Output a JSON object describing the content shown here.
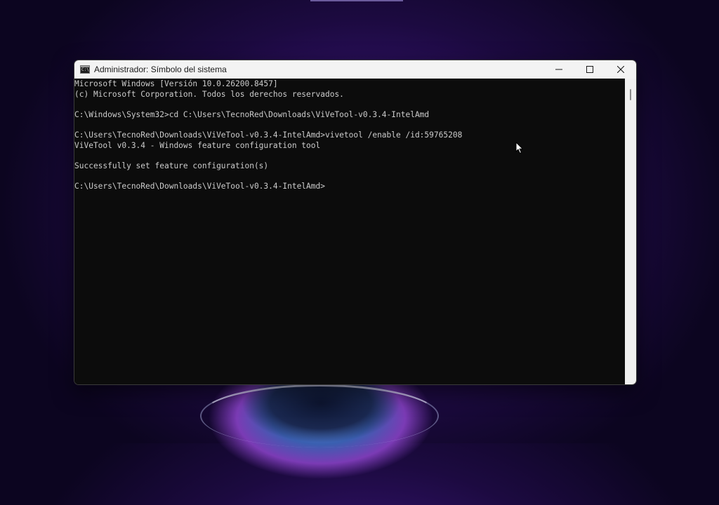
{
  "window": {
    "title": "Administrador: Símbolo del sistema",
    "app_icon_text": "C:\\"
  },
  "caption": {
    "minimize_icon": "minimize-icon",
    "maximize_icon": "maximize-icon",
    "close_icon": "close-icon"
  },
  "console": {
    "lines": [
      "Microsoft Windows [Versión 10.0.26200.8457]",
      "(c) Microsoft Corporation. Todos los derechos reservados.",
      "",
      "C:\\Windows\\System32>cd C:\\Users\\TecnoRed\\Downloads\\ViVeTool-v0.3.4-IntelAmd",
      "",
      "C:\\Users\\TecnoRed\\Downloads\\ViVeTool-v0.3.4-IntelAmd>vivetool /enable /id:59765208",
      "ViVeTool v0.3.4 - Windows feature configuration tool",
      "",
      "Successfully set feature configuration(s)",
      "",
      "C:\\Users\\TecnoRed\\Downloads\\ViVeTool-v0.3.4-IntelAmd>"
    ]
  },
  "colors": {
    "console_bg": "#0c0c0c",
    "console_text": "#cccccc",
    "titlebar_bg": "#f3f3f3"
  }
}
